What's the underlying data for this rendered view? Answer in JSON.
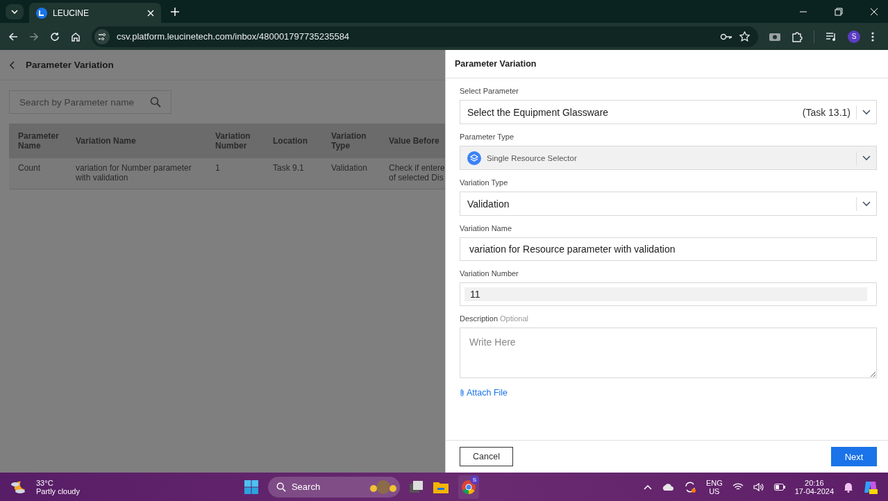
{
  "browser": {
    "tab_title": "LEUCINE",
    "url": "csv.platform.leucinetech.com/inbox/480001797735235584",
    "profile_initial": "S"
  },
  "page": {
    "title": "Parameter Variation",
    "search": {
      "placeholder": "Search by Parameter name"
    },
    "table": {
      "columns": [
        "Parameter Name",
        "Variation Name",
        "Variation Number",
        "Location",
        "Variation Type",
        "Value Before"
      ],
      "rows": [
        [
          "Count",
          "variation for Number parameter with validation",
          "1",
          "Task 9.1",
          "Validation",
          "Check if entere\nof selected Dis"
        ]
      ]
    }
  },
  "drawer": {
    "title": "Parameter Variation",
    "fields": [
      {
        "kind": "select",
        "label": "Select Parameter",
        "value": "Select the Equipment Glassware",
        "suffix": "(Task 13.1)",
        "disabled": false,
        "has_icon": false
      },
      {
        "kind": "select",
        "label": "Parameter Type",
        "value": "Single Resource Selector",
        "disabled": true,
        "has_icon": true
      },
      {
        "kind": "select",
        "label": "Variation Type",
        "value": "Validation",
        "disabled": false,
        "has_icon": false
      },
      {
        "kind": "input",
        "label": "Variation Name",
        "value": "variation for Resource parameter with validation",
        "disabled": false
      },
      {
        "kind": "input",
        "label": "Variation Number",
        "value": "11",
        "disabled": true
      },
      {
        "kind": "textarea",
        "label": "Description",
        "optional": "Optional",
        "placeholder": "Write Here"
      }
    ],
    "attach": "Attach File",
    "cancel": "Cancel",
    "next": "Next"
  },
  "taskbar": {
    "temperature": "33°C",
    "weather": "Partly cloudy",
    "search": "Search",
    "lang": "ENG",
    "region": "US",
    "time": "20:16",
    "date": "17-04-2024",
    "chrome_badge": "S"
  }
}
